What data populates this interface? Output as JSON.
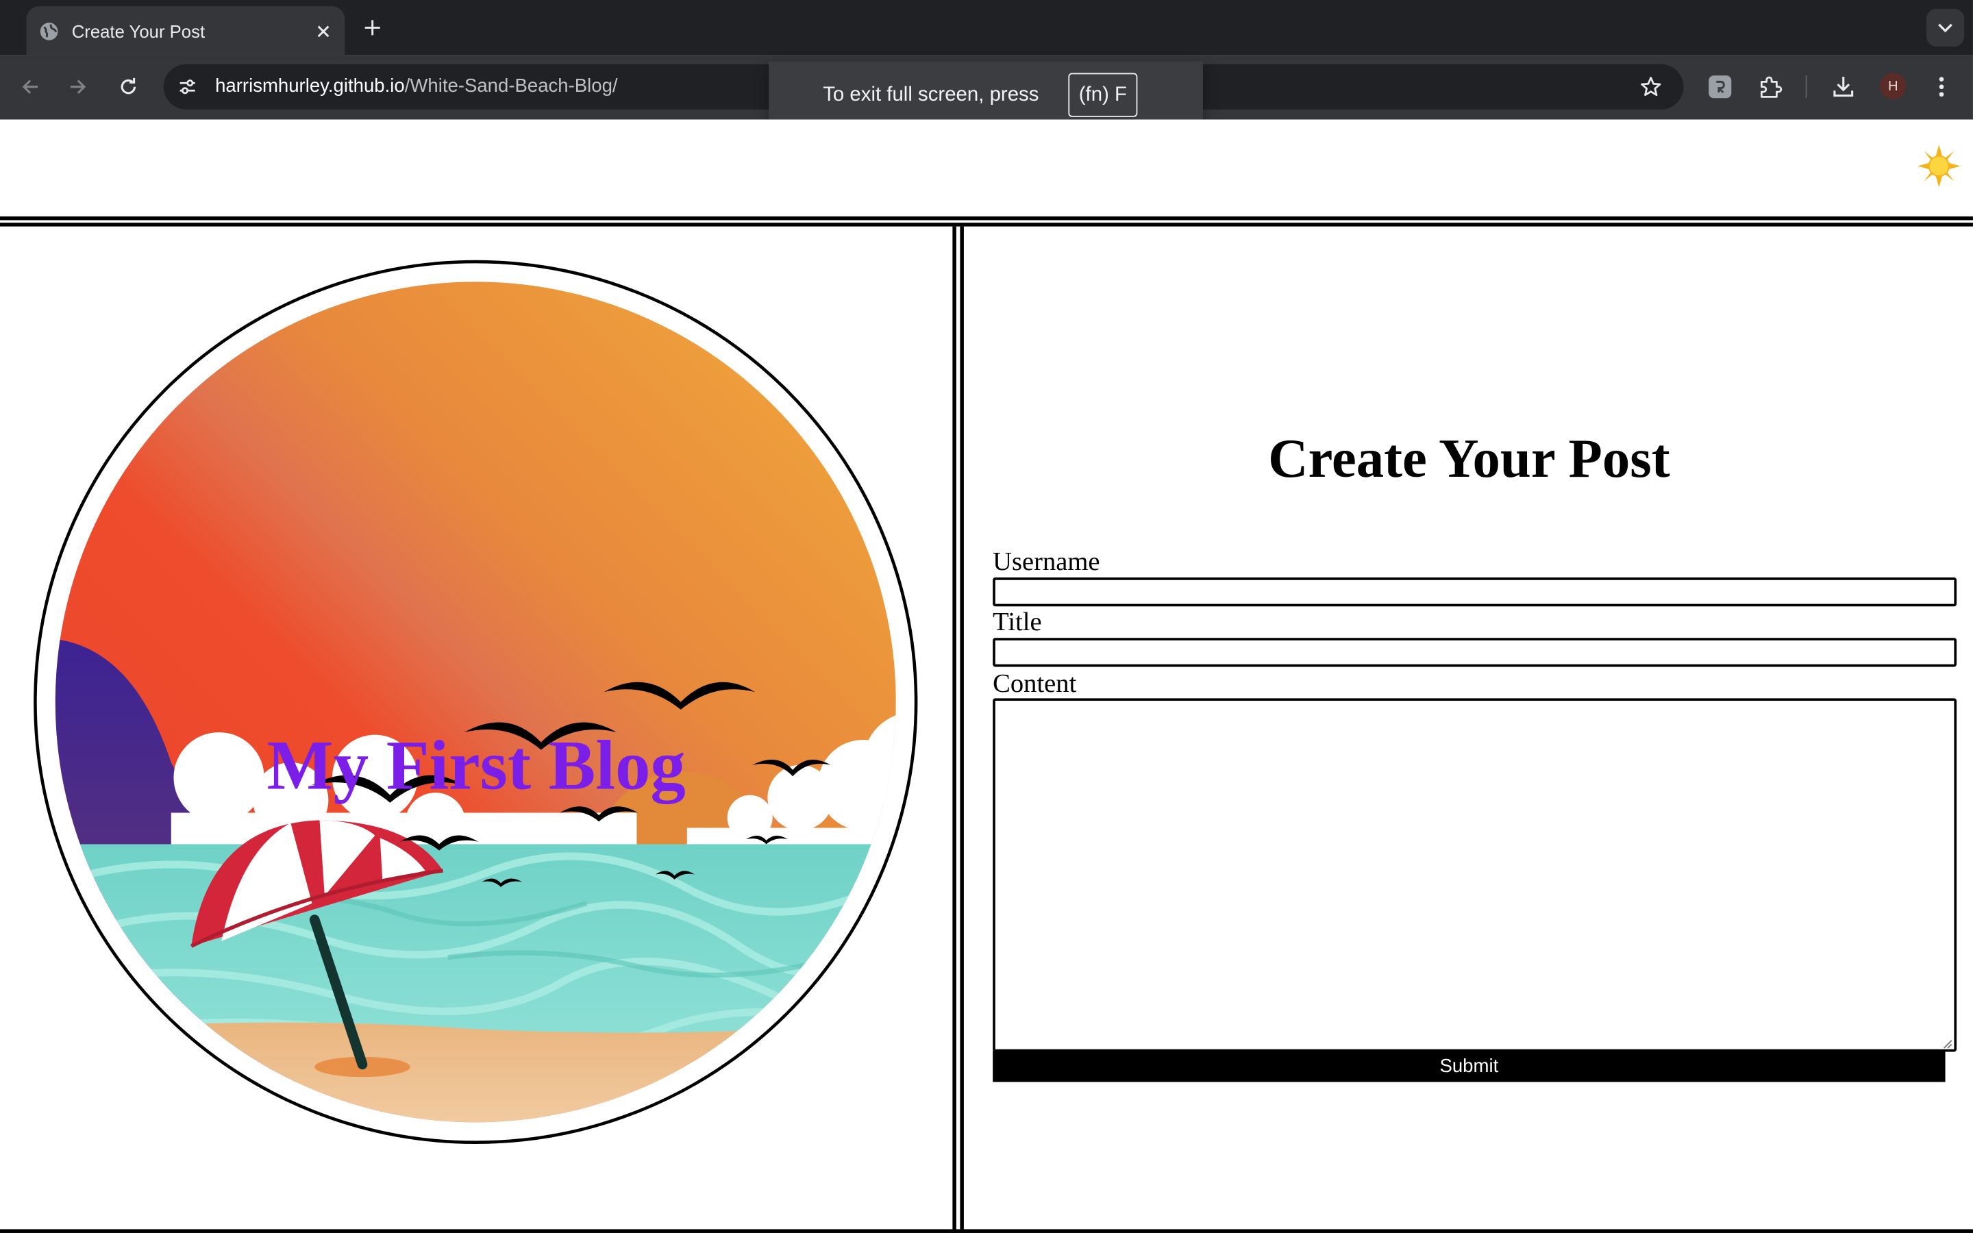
{
  "browser": {
    "tab": {
      "title": "Create Your Post"
    },
    "address": {
      "host": "harrismhurley.github.io",
      "path": "/White-Sand-Beach-Blog/"
    },
    "profile_initial": "H",
    "fullscreen_toast": {
      "message": "To exit full screen, press",
      "key": "(fn) F"
    }
  },
  "page": {
    "hero": {
      "title": "My First Blog"
    },
    "form": {
      "heading": "Create Your Post",
      "username_label": "Username",
      "username_value": "",
      "title_label": "Title",
      "title_value": "",
      "content_label": "Content",
      "content_value": "",
      "submit_label": "Submit"
    }
  },
  "colors": {
    "blog_title": "#7b1fe8",
    "chrome_bg": "#202124",
    "toolbar_bg": "#35363a",
    "submit_bg": "#000000"
  }
}
